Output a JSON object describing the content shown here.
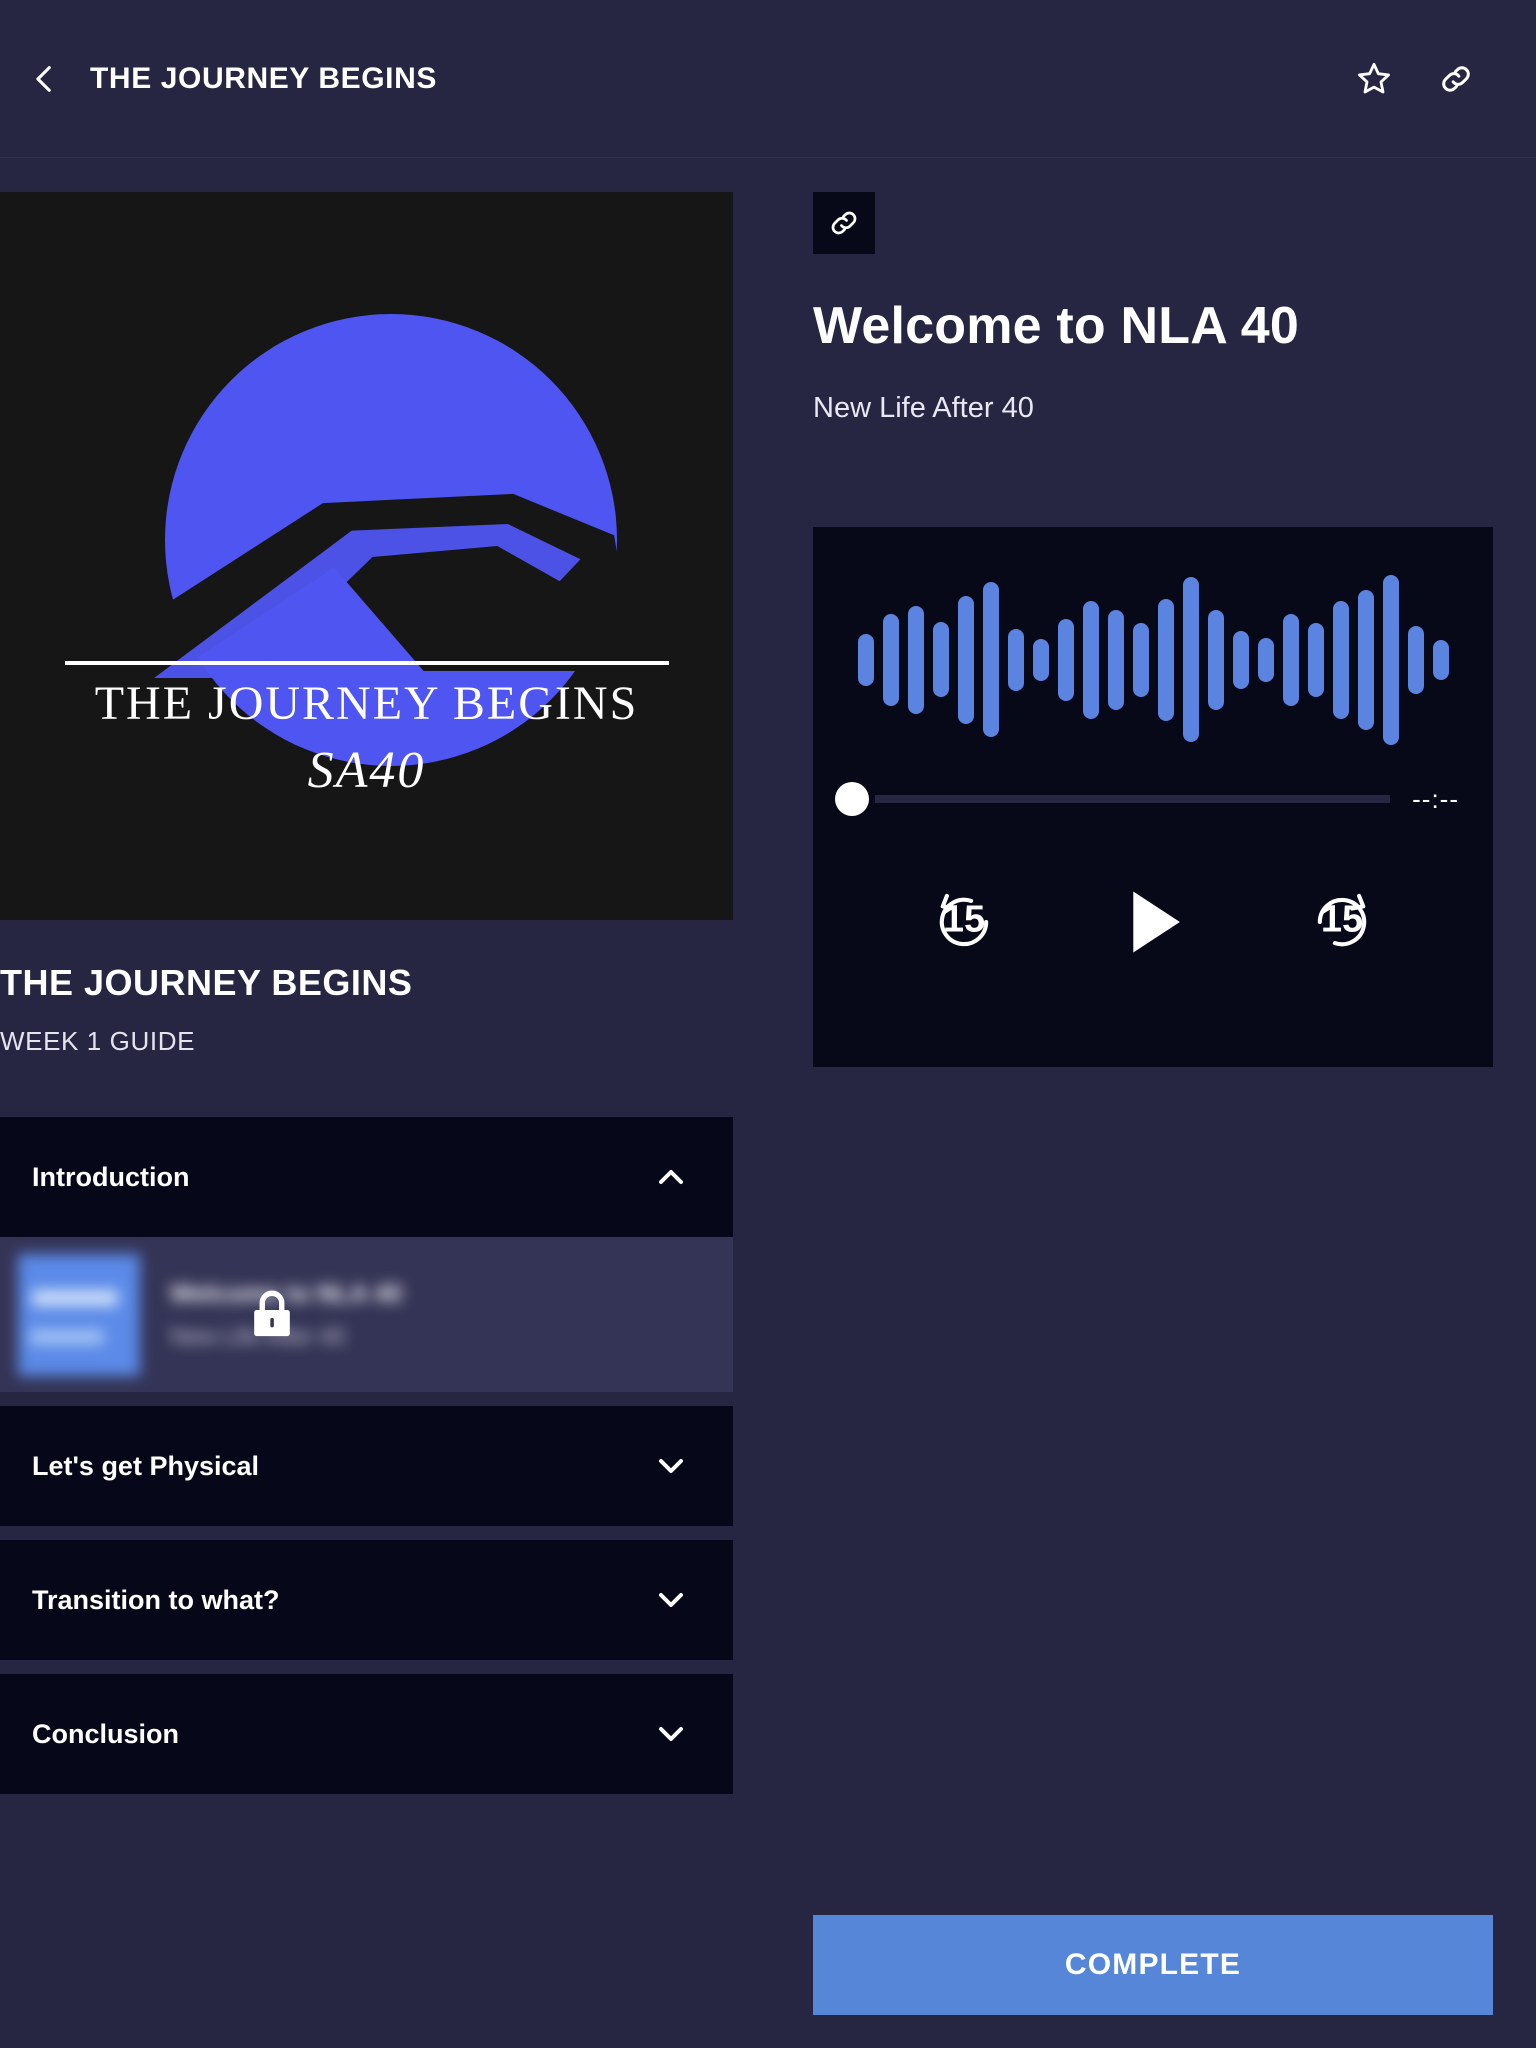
{
  "topbar": {
    "title": "THE JOURNEY BEGINS",
    "back_icon": "chevron-left-icon",
    "favorite_icon": "star-outline-icon",
    "share_icon": "link-icon"
  },
  "cover": {
    "title": "THE JOURNEY BEGINS",
    "signature": "SA40",
    "alt": "the-journey-begins-cover-art"
  },
  "course": {
    "title": "THE JOURNEY BEGINS",
    "subtitle": "WEEK 1 GUIDE"
  },
  "accordion": {
    "sections": [
      {
        "label": "Introduction",
        "expanded": true,
        "chevron": "chevron-up-icon",
        "lessons": [
          {
            "name": "Welcome to NLA 40",
            "subtitle": "New Life After 40",
            "locked": true,
            "lock_icon": "lock-icon"
          }
        ]
      },
      {
        "label": "Let's get Physical",
        "expanded": false,
        "chevron": "chevron-down-icon",
        "lessons": []
      },
      {
        "label": "Transition to what?",
        "expanded": false,
        "chevron": "chevron-down-icon",
        "lessons": []
      },
      {
        "label": "Conclusion",
        "expanded": false,
        "chevron": "chevron-down-icon",
        "lessons": []
      }
    ]
  },
  "detail": {
    "share_icon": "link-icon",
    "title": "Welcome to NLA 40",
    "author": "New Life After 40"
  },
  "player": {
    "time_display": "--:--",
    "progress_percent": 0,
    "rewind_label": "15",
    "forward_label": "15",
    "rewind_icon": "replay-15-icon",
    "play_icon": "play-icon",
    "forward_icon": "forward-15-icon",
    "waveform_heights": [
      52,
      92,
      108,
      75,
      128,
      155,
      62,
      42,
      82,
      118,
      100,
      74,
      122,
      165,
      100,
      58,
      44,
      92,
      74,
      118,
      140,
      170,
      68,
      40
    ]
  },
  "footer": {
    "complete_label": "COMPLETE"
  },
  "colors": {
    "page_bg": "#262542",
    "panel_dark": "#060718",
    "accent_blue": "#5686d8",
    "waveform_blue": "#5b84e0",
    "cover_blue": "#4f55f0"
  }
}
